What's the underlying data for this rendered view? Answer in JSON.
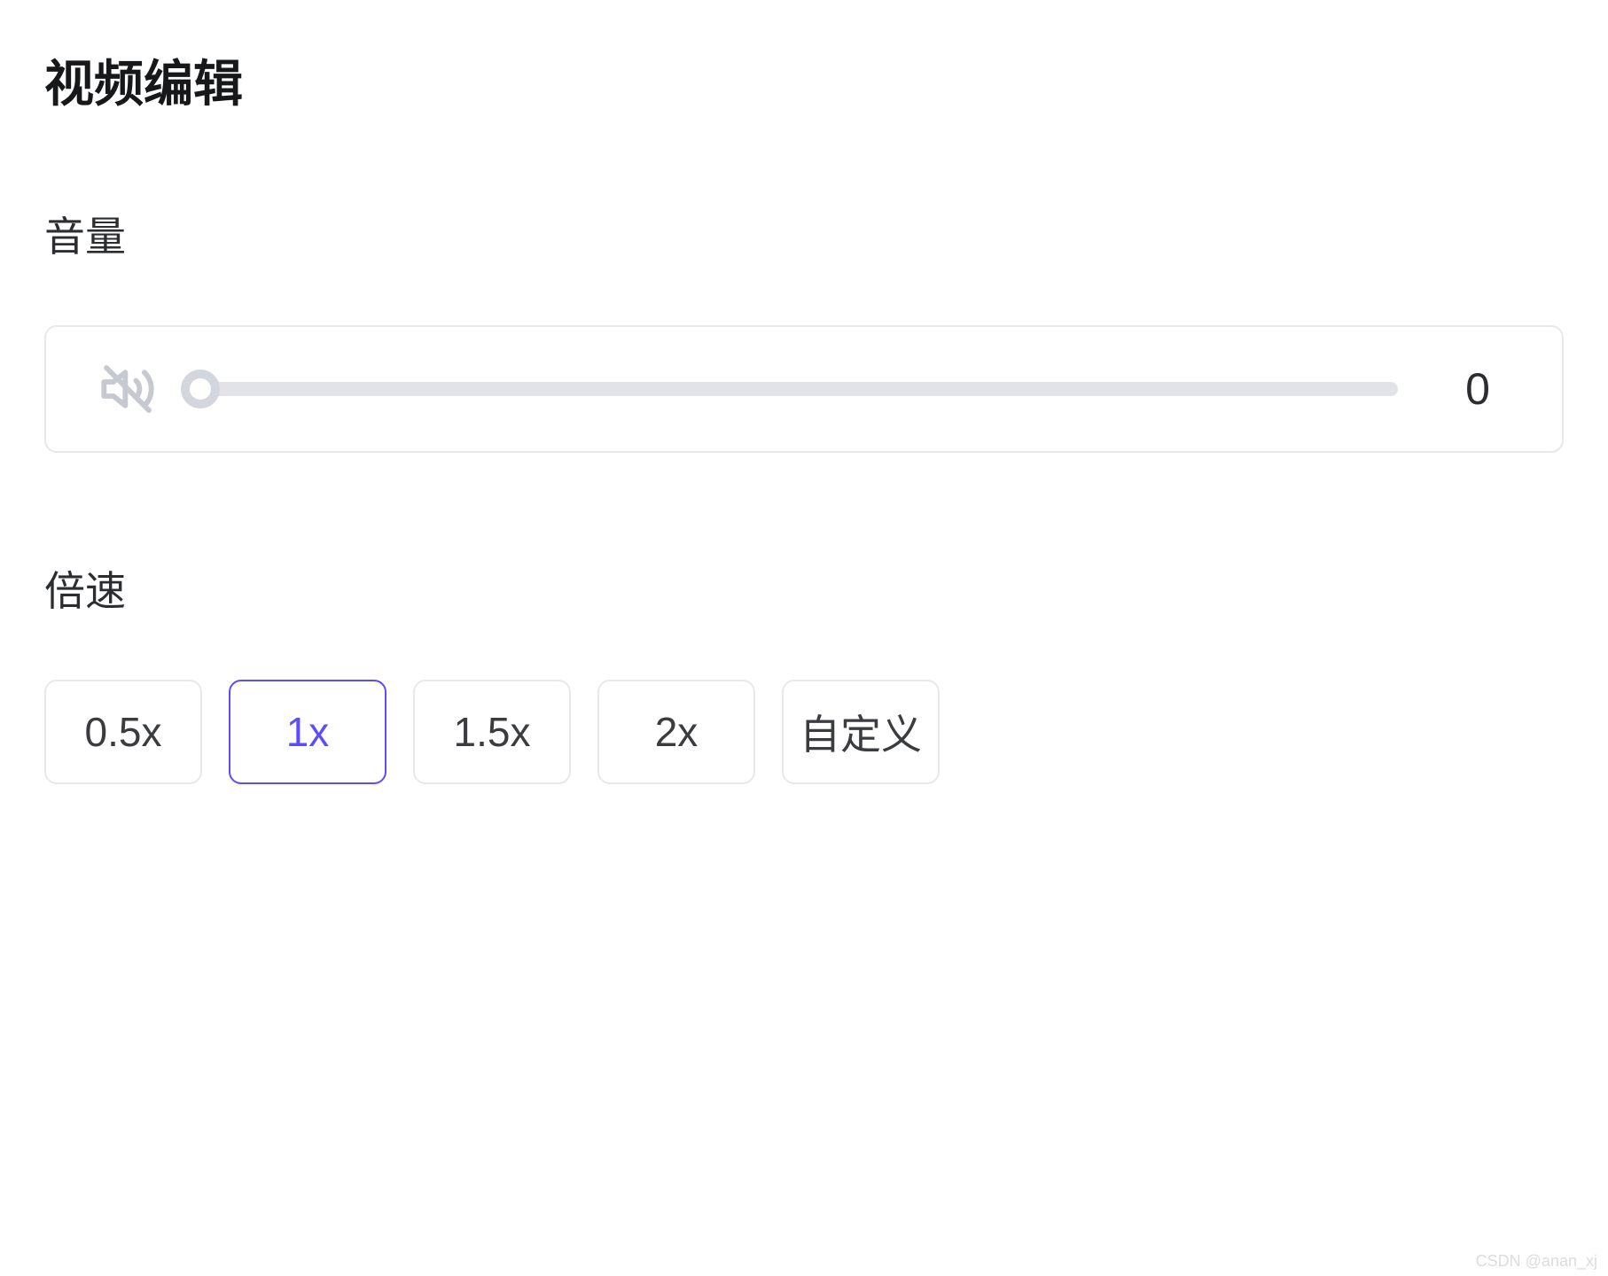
{
  "title": "视频编辑",
  "volume": {
    "label": "音量",
    "value": "0",
    "percent": 0
  },
  "speed": {
    "label": "倍速",
    "options": [
      {
        "label": "0.5x",
        "selected": false
      },
      {
        "label": "1x",
        "selected": true
      },
      {
        "label": "1.5x",
        "selected": false
      },
      {
        "label": "2x",
        "selected": false
      },
      {
        "label": "自定义",
        "selected": false
      }
    ]
  },
  "watermark": "CSDN @anan_xj"
}
